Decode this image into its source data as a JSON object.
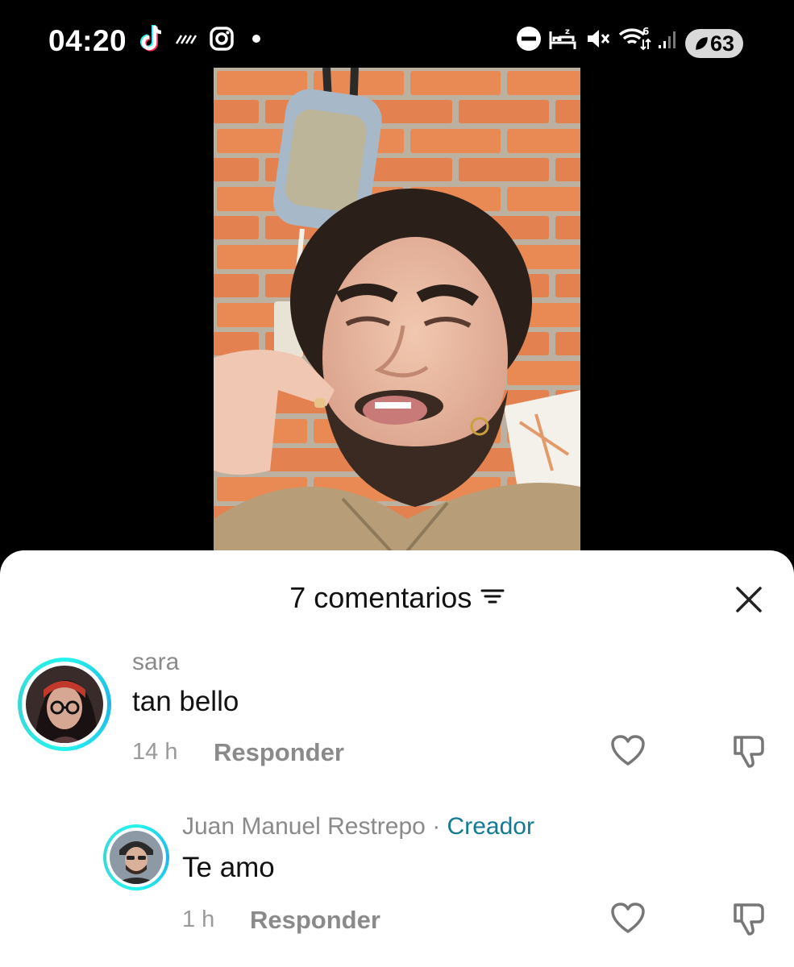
{
  "status_bar": {
    "time": "04:20",
    "battery": "63",
    "icons": [
      "tiktok-icon",
      "activity-icon",
      "instagram-icon",
      "dot-icon",
      "do-not-disturb-icon",
      "sleep-icon",
      "mute-icon",
      "wifi-icon",
      "signal-icon",
      "battery-icon"
    ]
  },
  "video": {
    "description_icon": "video-thumbnail"
  },
  "comments_sheet": {
    "title": "7 comentarios",
    "sort_icon": "sort-icon",
    "close_icon": "close-icon",
    "comments": [
      {
        "username": "sara",
        "text": "tan bello",
        "time": "14 h",
        "reply_label": "Responder"
      },
      {
        "username": "Juan Manuel Restrepo",
        "separator": "·",
        "badge": "Creador",
        "text": "Te amo",
        "time": "1 h",
        "reply_label": "Responder"
      }
    ]
  },
  "colors": {
    "background": "#000000",
    "sheet": "#ffffff",
    "creator_badge": "#127a96",
    "avatar_ring": "#25f4ee",
    "muted_text": "#8a8a8a"
  }
}
